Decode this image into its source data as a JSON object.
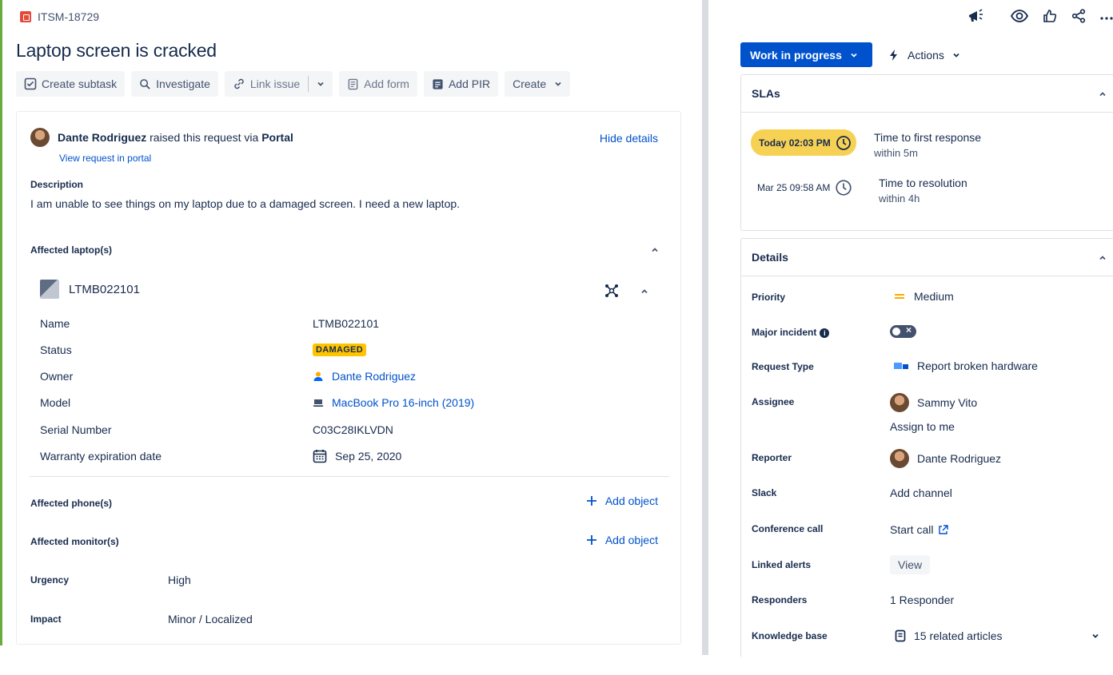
{
  "issue": {
    "key": "ITSM-18729",
    "title": "Laptop screen is cracked"
  },
  "toolbar": {
    "create_subtask": "Create subtask",
    "investigate": "Investigate",
    "link_issue": "Link issue",
    "add_form": "Add form",
    "add_pir": "Add PIR",
    "create": "Create"
  },
  "request": {
    "reporter_name": "Dante Rodriguez",
    "raised_text": "raised this request via",
    "channel": "Portal",
    "view_portal": "View request in portal",
    "hide_details": "Hide details",
    "description_label": "Description",
    "description": "I am unable to see things on my laptop due to a damaged screen. I need a new laptop."
  },
  "affected_laptops": {
    "label": "Affected laptop(s)",
    "asset_id": "LTMB022101",
    "rows": [
      {
        "label": "Name",
        "value": "LTMB022101"
      },
      {
        "label": "Status",
        "value": "DAMAGED"
      },
      {
        "label": "Owner",
        "value": "Dante Rodriguez"
      },
      {
        "label": "Model",
        "value": "MacBook Pro 16-inch (2019)"
      },
      {
        "label": "Serial Number",
        "value": "C03C28IKLVDN"
      },
      {
        "label": "Warranty expiration date",
        "value": "Sep 25, 2020"
      }
    ]
  },
  "affected_phones": {
    "label": "Affected phone(s)",
    "action": "Add object"
  },
  "affected_monitors": {
    "label": "Affected monitor(s)",
    "action": "Add object"
  },
  "urgency": {
    "label": "Urgency",
    "value": "High"
  },
  "impact": {
    "label": "Impact",
    "value": "Minor / Localized"
  },
  "status": {
    "label": "Work in progress"
  },
  "actions": {
    "label": "Actions"
  },
  "slas": {
    "title": "SLAs",
    "items": [
      {
        "time": "Today 02:03 PM",
        "name": "Time to first response",
        "target": "within 5m"
      },
      {
        "time": "Mar 25 09:58 AM",
        "name": "Time to resolution",
        "target": "within 4h"
      }
    ]
  },
  "details": {
    "title": "Details",
    "priority": {
      "label": "Priority",
      "value": "Medium"
    },
    "major_incident": {
      "label": "Major incident"
    },
    "request_type": {
      "label": "Request Type",
      "value": "Report broken hardware"
    },
    "assignee": {
      "label": "Assignee",
      "value": "Sammy Vito",
      "assign_to_me": "Assign to me"
    },
    "reporter": {
      "label": "Reporter",
      "value": "Dante Rodriguez"
    },
    "slack": {
      "label": "Slack",
      "value": "Add channel"
    },
    "conference_call": {
      "label": "Conference call",
      "value": "Start call"
    },
    "linked_alerts": {
      "label": "Linked alerts",
      "value": "View"
    },
    "responders": {
      "label": "Responders",
      "value": "1 Responder"
    },
    "knowledge_base": {
      "label": "Knowledge base",
      "value": "15 related articles"
    }
  },
  "colors": {
    "primary": "#0052cc",
    "sla_warning": "#f7d154",
    "damaged_badge": "#ffc400",
    "priority_medium": "#ffab00",
    "text": "#172b4d"
  }
}
